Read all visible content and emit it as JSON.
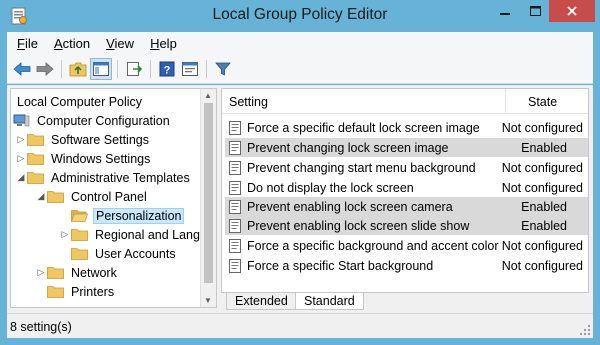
{
  "window": {
    "title": "Local Group Policy Editor"
  },
  "menu": [
    {
      "label": "File",
      "key": "F",
      "rest": "ile"
    },
    {
      "label": "Action",
      "key": "A",
      "rest": "ction"
    },
    {
      "label": "View",
      "key": "V",
      "rest": "iew"
    },
    {
      "label": "Help",
      "key": "H",
      "rest": "elp"
    }
  ],
  "toolbar": {
    "icons": [
      "back-arrow-icon",
      "forward-arrow-icon",
      "up-folder-icon",
      "show-hide-tree-icon",
      "export-list-icon",
      "help-icon",
      "properties-icon",
      "filter-icon"
    ]
  },
  "tree": {
    "items": [
      {
        "label": "Local Computer Policy",
        "level": 0,
        "icon": "none",
        "expander": ""
      },
      {
        "label": "Computer Configuration",
        "level": 0,
        "icon": "computer-icon",
        "expander": "open"
      },
      {
        "label": "Software Settings",
        "level": 1,
        "icon": "folder-icon",
        "expander": "closed"
      },
      {
        "label": "Windows Settings",
        "level": 1,
        "icon": "folder-icon",
        "expander": "closed"
      },
      {
        "label": "Administrative Templates",
        "level": 1,
        "icon": "folder-icon",
        "expander": "open"
      },
      {
        "label": "Control Panel",
        "level": 2,
        "icon": "folder-icon",
        "expander": "open"
      },
      {
        "label": "Personalization",
        "level": 3,
        "icon": "folder-open-icon",
        "expander": "",
        "selected": true
      },
      {
        "label": "Regional and Lang",
        "level": 3,
        "icon": "folder-icon",
        "expander": "closed"
      },
      {
        "label": "User Accounts",
        "level": 3,
        "icon": "folder-icon",
        "expander": ""
      },
      {
        "label": "Network",
        "level": 2,
        "icon": "folder-icon",
        "expander": "closed"
      },
      {
        "label": "Printers",
        "level": 2,
        "icon": "folder-icon",
        "expander": ""
      }
    ]
  },
  "list": {
    "columns": {
      "setting": "Setting",
      "state": "State"
    },
    "rows": [
      {
        "name": "Force a specific default lock screen image",
        "state": "Not configured",
        "highlight": false
      },
      {
        "name": "Prevent changing lock screen image",
        "state": "Enabled",
        "highlight": true
      },
      {
        "name": "Prevent changing start menu background",
        "state": "Not configured",
        "highlight": false
      },
      {
        "name": "Do not display the lock screen",
        "state": "Not configured",
        "highlight": false
      },
      {
        "name": "Prevent enabling lock screen camera",
        "state": "Enabled",
        "highlight": true
      },
      {
        "name": "Prevent enabling lock screen slide show",
        "state": "Enabled",
        "highlight": true
      },
      {
        "name": "Force a specific background and accent color",
        "state": "Not configured",
        "highlight": false
      },
      {
        "name": "Force a specific Start background",
        "state": "Not configured",
        "highlight": false
      }
    ]
  },
  "tabs": {
    "extended": "Extended",
    "standard": "Standard"
  },
  "status": {
    "text": "8 setting(s)"
  },
  "colors": {
    "frame": "#67b3d8",
    "close_button": "#c74d4a",
    "selected_bg": "#cce8ff",
    "enabled_row": "#d9d9d9",
    "folder": "#f0c75e"
  }
}
